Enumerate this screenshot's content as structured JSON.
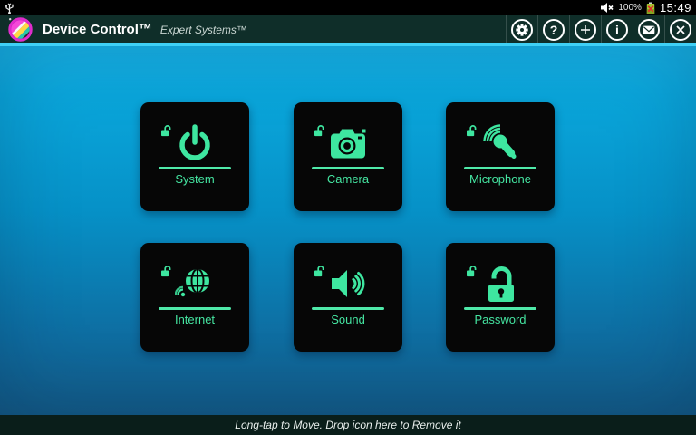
{
  "status_bar": {
    "usb_icon": "usb-icon",
    "mute_icon": "volume-muted-icon",
    "battery_percent": "100%",
    "battery_icon": "battery-error-icon",
    "time": "15:49"
  },
  "header": {
    "app_icon": "device-control-logo",
    "title": "Device Control™",
    "subtitle": "Expert Systems™",
    "actions": [
      {
        "id": "settings",
        "icon": "gear-icon"
      },
      {
        "id": "help",
        "icon": "question-icon",
        "glyph": "?"
      },
      {
        "id": "add",
        "icon": "plus-icon"
      },
      {
        "id": "info",
        "icon": "info-icon",
        "glyph": "i"
      },
      {
        "id": "mail",
        "icon": "mail-icon"
      },
      {
        "id": "close",
        "icon": "close-icon"
      }
    ]
  },
  "tiles": [
    {
      "id": "system",
      "label": "System",
      "icon": "power-icon",
      "lock_state": "unlocked"
    },
    {
      "id": "camera",
      "label": "Camera",
      "icon": "camera-icon",
      "lock_state": "unlocked"
    },
    {
      "id": "microphone",
      "label": "Microphone",
      "icon": "microphone-icon",
      "lock_state": "unlocked"
    },
    {
      "id": "internet",
      "label": "Internet",
      "icon": "globe-icon",
      "lock_state": "unlocked"
    },
    {
      "id": "sound",
      "label": "Sound",
      "icon": "speaker-icon",
      "lock_state": "unlocked"
    },
    {
      "id": "password",
      "label": "Password",
      "icon": "padlock-icon",
      "lock_state": "unlocked"
    }
  ],
  "footer": {
    "hint": "Long-tap to Move. Drop icon here to Remove it"
  },
  "colors": {
    "accent_green": "#3ee6a0",
    "tile_bg": "#060606",
    "header_bg": "#0f2e29",
    "accent_cyan": "#3fd0f6",
    "background_top": "#18b2e6",
    "background_bottom": "#135a86"
  }
}
